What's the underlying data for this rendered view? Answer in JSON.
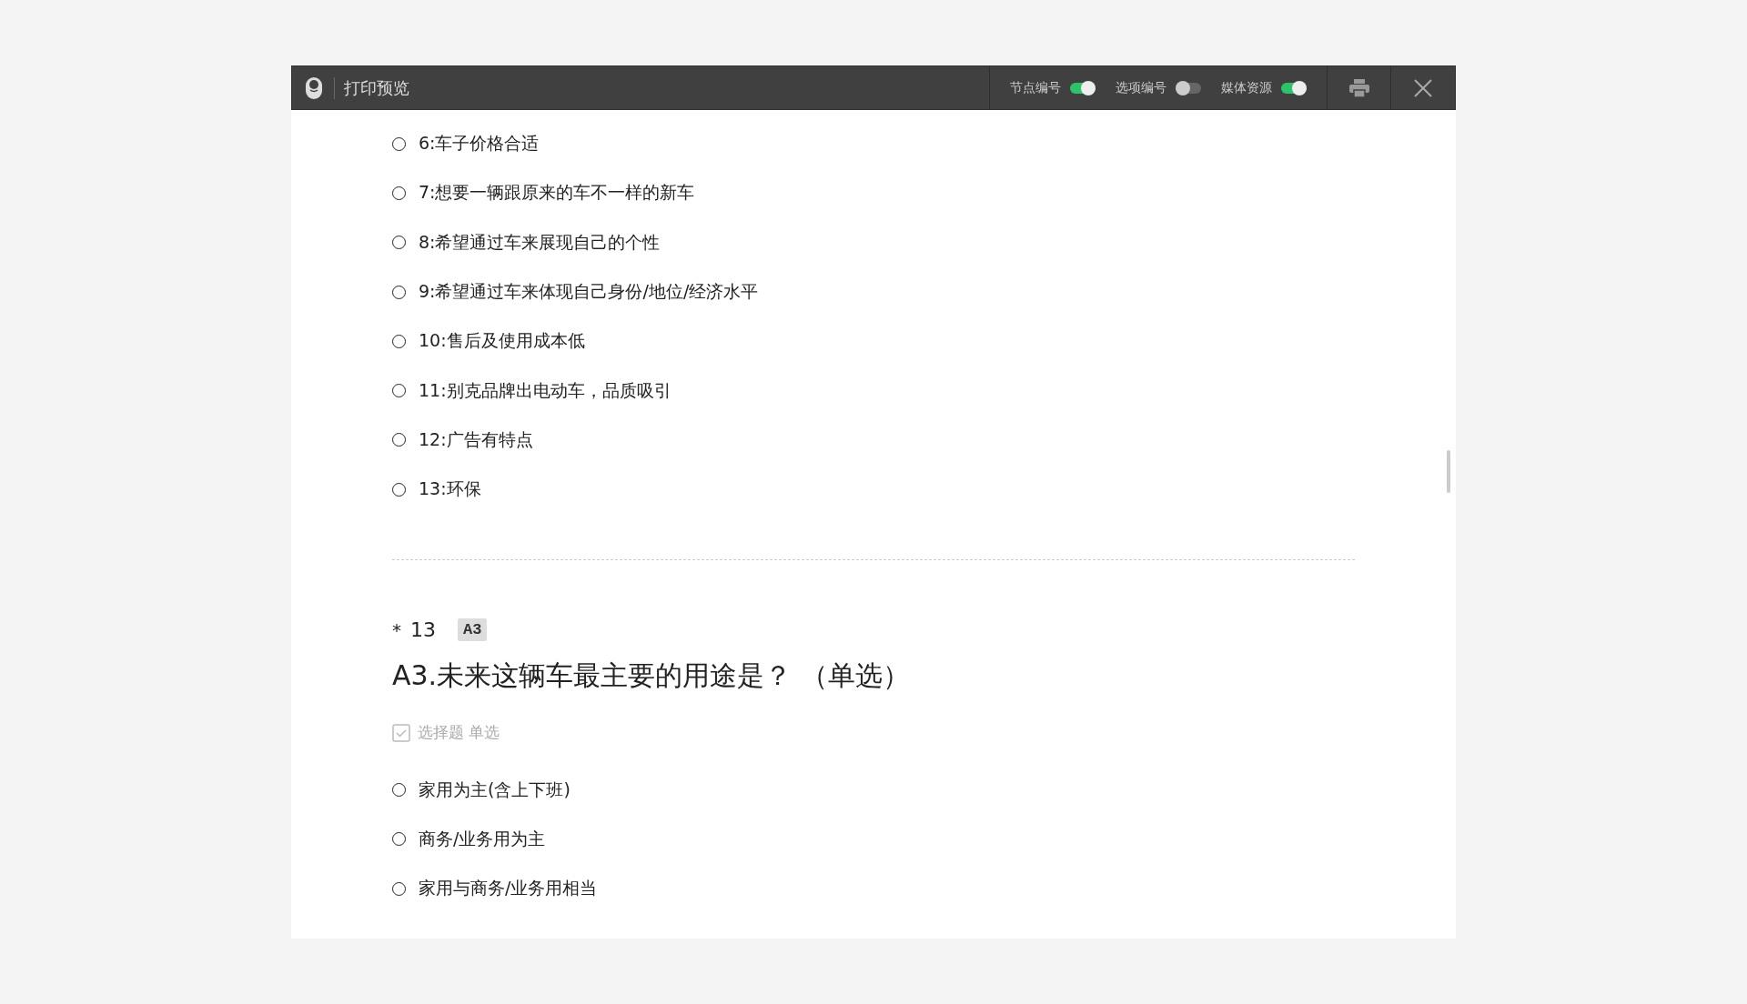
{
  "window": {
    "title": "打印预览"
  },
  "toggles": [
    {
      "label": "节点编号",
      "on": true
    },
    {
      "label": "选项编号",
      "on": false
    },
    {
      "label": "媒体资源",
      "on": true
    }
  ],
  "previous_options": [
    {
      "label": "6:车子价格合适",
      "selected": false
    },
    {
      "label": "7:想要一辆跟原来的车不一样的新车",
      "selected": false
    },
    {
      "label": "8:希望通过车来展现自己的个性",
      "selected": false
    },
    {
      "label": "9:希望通过车来体现自己身份/地位/经济水平",
      "selected": false
    },
    {
      "label": "10:售后及使用成本低",
      "selected": false
    },
    {
      "label": "11:别克品牌出电动车，品质吸引",
      "selected": false
    },
    {
      "label": "12:广告有特点",
      "selected": false
    },
    {
      "label": "13:环保",
      "selected": false
    }
  ],
  "question": {
    "required_mark": "*",
    "number": "13",
    "code": "A3",
    "title": "A3.未来这辆车最主要的用途是？ （单选）",
    "type": "选择题 单选",
    "options": [
      {
        "label": "家用为主(含上下班)",
        "selected": false
      },
      {
        "label": "商务/业务用为主",
        "selected": false
      },
      {
        "label": "家用与商务/业务用相当",
        "selected": false
      }
    ]
  }
}
